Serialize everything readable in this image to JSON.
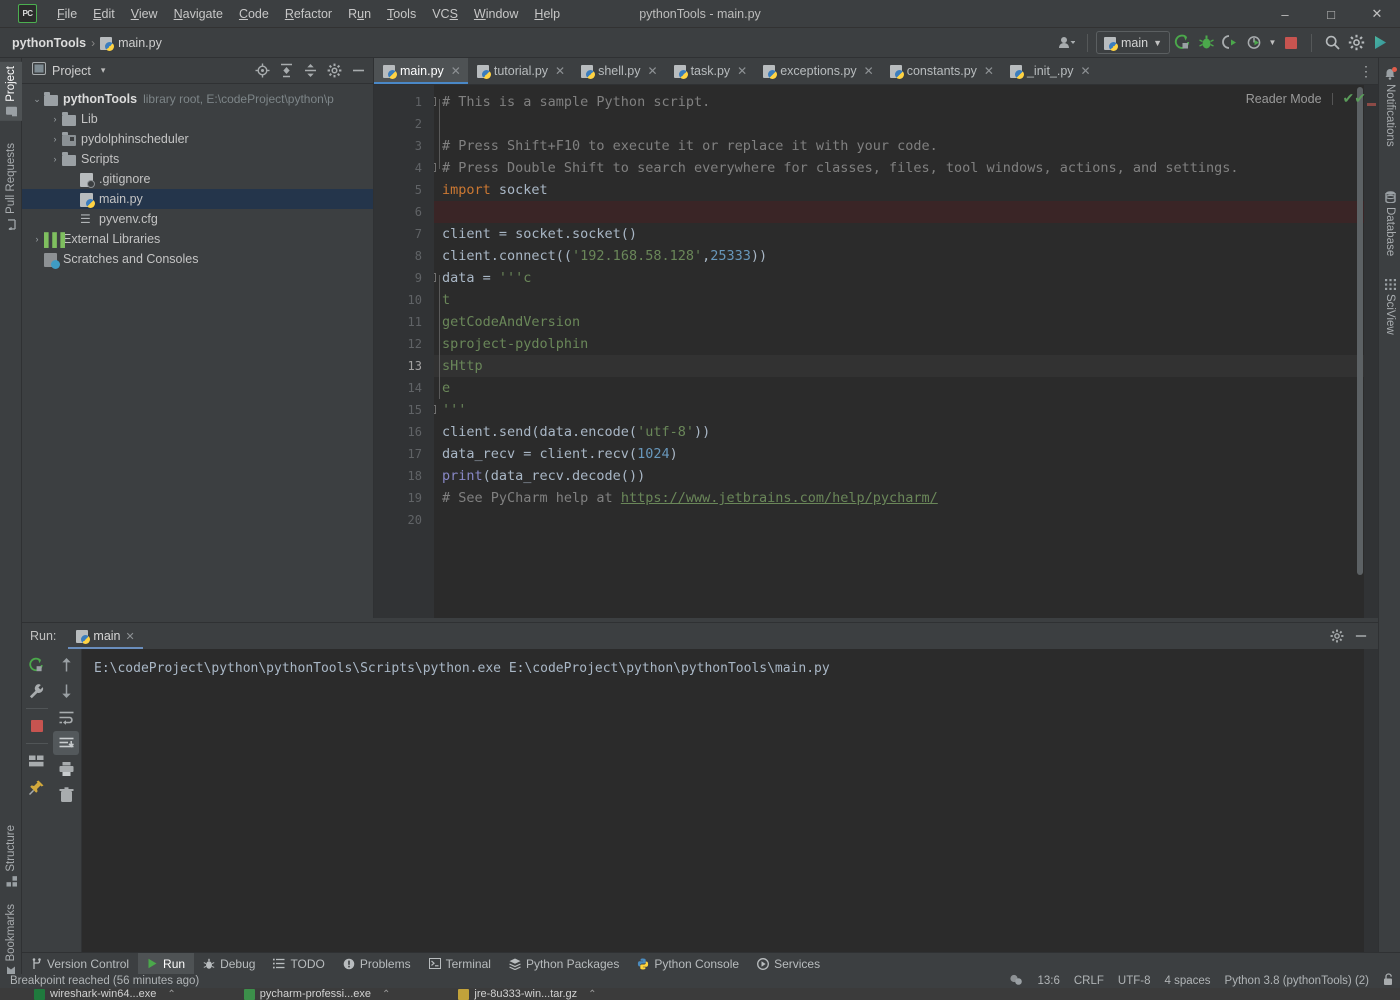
{
  "window": {
    "title": "pythonTools - main.py",
    "logo_text": "PC",
    "controls": {
      "minimize": "–",
      "maximize": "□",
      "close": "✕"
    }
  },
  "menu": [
    {
      "label": "File",
      "mnemonic": "F"
    },
    {
      "label": "Edit",
      "mnemonic": "E"
    },
    {
      "label": "View",
      "mnemonic": "V"
    },
    {
      "label": "Navigate",
      "mnemonic": "N"
    },
    {
      "label": "Code",
      "mnemonic": "C"
    },
    {
      "label": "Refactor",
      "mnemonic": "R"
    },
    {
      "label": "Run",
      "mnemonic": "u"
    },
    {
      "label": "Tools",
      "mnemonic": "T"
    },
    {
      "label": "VCS",
      "mnemonic": "S"
    },
    {
      "label": "Window",
      "mnemonic": "W"
    },
    {
      "label": "Help",
      "mnemonic": "H"
    }
  ],
  "navbar": {
    "breadcrumb_project": "pythonTools",
    "breadcrumb_sep": "›",
    "breadcrumb_file": "main.py",
    "run_config": "main",
    "icons": {
      "account": "account-icon",
      "run": "run-icon",
      "debug": "debug-icon",
      "run_coverage": "run-with-coverage-icon",
      "profile": "profile-icon",
      "stop": "stop-icon",
      "search": "search-everywhere-icon",
      "settings": "settings-icon",
      "updates": "updates-icon"
    }
  },
  "left_strip": {
    "top": [
      {
        "label": "Project",
        "icon": "project-icon",
        "selected": true
      },
      {
        "label": "Pull Requests",
        "icon": "pull-request-icon",
        "selected": false
      }
    ],
    "bottom": [
      {
        "label": "Structure",
        "icon": "structure-icon"
      },
      {
        "label": "Bookmarks",
        "icon": "bookmarks-icon"
      }
    ]
  },
  "right_strip": {
    "items": [
      {
        "label": "Notifications",
        "icon": "bell-icon",
        "badge": true
      },
      {
        "label": "Database",
        "icon": "database-icon",
        "badge": false
      },
      {
        "label": "SciView",
        "icon": "sciview-icon",
        "badge": false
      }
    ]
  },
  "project_panel": {
    "title": "Project",
    "dropdown": "▾",
    "toolbar": [
      {
        "name": "select-opened-file-icon",
        "glyph": "⊕"
      },
      {
        "name": "expand-all-icon",
        "glyph": "⇱"
      },
      {
        "name": "collapse-all-icon",
        "glyph": "⇲"
      },
      {
        "name": "settings-gear-icon",
        "glyph": "⚙"
      },
      {
        "name": "hide-panel-icon",
        "glyph": "—"
      }
    ],
    "tree": [
      {
        "depth": 0,
        "arrow": "⌄",
        "icon": "folder",
        "label": "pythonTools",
        "bold": true,
        "meta": "library root,  E:\\codeProject\\python\\p",
        "selected": false
      },
      {
        "depth": 1,
        "arrow": "›",
        "icon": "folder",
        "label": "Lib",
        "bold": false,
        "meta": "",
        "selected": false
      },
      {
        "depth": 1,
        "arrow": "›",
        "icon": "folder-module",
        "label": "pydolphinscheduler",
        "bold": false,
        "meta": "",
        "selected": false
      },
      {
        "depth": 1,
        "arrow": "›",
        "icon": "folder",
        "label": "Scripts",
        "bold": false,
        "meta": "",
        "selected": false
      },
      {
        "depth": 2,
        "arrow": "",
        "icon": "gitignore",
        "label": ".gitignore",
        "bold": false,
        "meta": "",
        "selected": false
      },
      {
        "depth": 2,
        "arrow": "",
        "icon": "python",
        "label": "main.py",
        "bold": false,
        "meta": "",
        "selected": true
      },
      {
        "depth": 2,
        "arrow": "",
        "icon": "cfg",
        "label": "pyvenv.cfg",
        "bold": false,
        "meta": "",
        "selected": false
      },
      {
        "depth": 0,
        "arrow": "›",
        "icon": "library",
        "label": "External Libraries",
        "bold": false,
        "meta": "",
        "selected": false
      },
      {
        "depth": 0,
        "arrow": "",
        "icon": "scratches",
        "label": "Scratches and Consoles",
        "bold": false,
        "meta": "",
        "selected": false
      }
    ]
  },
  "editor": {
    "tabs": [
      {
        "label": "main.py",
        "active": true
      },
      {
        "label": "tutorial.py",
        "active": false
      },
      {
        "label": "shell.py",
        "active": false
      },
      {
        "label": "task.py",
        "active": false
      },
      {
        "label": "exceptions.py",
        "active": false
      },
      {
        "label": "constants.py",
        "active": false
      },
      {
        "label": "_init_.py",
        "active": false
      }
    ],
    "tab_close_glyph": "✕",
    "more_tabs_glyph": "⋮",
    "reader_mode_label": "Reader Mode",
    "inspection_glyph": "✔",
    "current_line": 13,
    "breakpoint_line": 6,
    "lines": [
      {
        "n": 1,
        "segments": [
          {
            "t": "# This is a sample Python script.",
            "c": "cmt"
          }
        ]
      },
      {
        "n": 2,
        "segments": [
          {
            "t": "",
            "c": ""
          }
        ]
      },
      {
        "n": 3,
        "segments": [
          {
            "t": "# Press Shift+F10 to execute it or replace it with your code.",
            "c": "cmt"
          }
        ]
      },
      {
        "n": 4,
        "segments": [
          {
            "t": "# Press Double Shift to search everywhere for classes, files, tool windows, actions, and settings.",
            "c": "cmt"
          }
        ]
      },
      {
        "n": 5,
        "segments": [
          {
            "t": "import",
            "c": "kw"
          },
          {
            "t": " socket",
            "c": ""
          }
        ]
      },
      {
        "n": 6,
        "segments": [
          {
            "t": "",
            "c": ""
          }
        ]
      },
      {
        "n": 7,
        "segments": [
          {
            "t": "client = socket.socket()",
            "c": ""
          }
        ]
      },
      {
        "n": 8,
        "segments": [
          {
            "t": "client.connect((",
            "c": ""
          },
          {
            "t": "'192.168.58.128'",
            "c": "str"
          },
          {
            "t": ",",
            "c": ""
          },
          {
            "t": "25333",
            "c": "num"
          },
          {
            "t": "))",
            "c": ""
          }
        ]
      },
      {
        "n": 9,
        "segments": [
          {
            "t": "data = ",
            "c": ""
          },
          {
            "t": "'''c",
            "c": "str"
          }
        ]
      },
      {
        "n": 10,
        "segments": [
          {
            "t": "t",
            "c": "str"
          }
        ]
      },
      {
        "n": 11,
        "segments": [
          {
            "t": "getCodeAndVersion",
            "c": "str"
          }
        ]
      },
      {
        "n": 12,
        "segments": [
          {
            "t": "sproject-pydolphin",
            "c": "str"
          }
        ]
      },
      {
        "n": 13,
        "segments": [
          {
            "t": "sHttp",
            "c": "str"
          }
        ]
      },
      {
        "n": 14,
        "segments": [
          {
            "t": "e",
            "c": "str"
          }
        ]
      },
      {
        "n": 15,
        "segments": [
          {
            "t": "'''",
            "c": "str"
          }
        ]
      },
      {
        "n": 16,
        "segments": [
          {
            "t": "client.send(data.encode(",
            "c": ""
          },
          {
            "t": "'utf-8'",
            "c": "str"
          },
          {
            "t": "))",
            "c": ""
          }
        ]
      },
      {
        "n": 17,
        "segments": [
          {
            "t": "data_recv = client.recv(",
            "c": ""
          },
          {
            "t": "1024",
            "c": "num"
          },
          {
            "t": ")",
            "c": ""
          }
        ]
      },
      {
        "n": 18,
        "segments": [
          {
            "t": "print",
            "c": "bi"
          },
          {
            "t": "(data_recv.decode())",
            "c": ""
          }
        ]
      },
      {
        "n": 19,
        "segments": [
          {
            "t": "# See PyCharm help at ",
            "c": "cmt"
          },
          {
            "t": "https://www.jetbrains.com/help/pycharm/",
            "c": "link"
          }
        ]
      },
      {
        "n": 20,
        "segments": [
          {
            "t": "",
            "c": ""
          }
        ]
      }
    ]
  },
  "run_panel": {
    "label": "Run:",
    "tab": "main",
    "tab_close_glyph": "✕",
    "header_icons": [
      {
        "name": "settings-gear-icon",
        "glyph": "⚙"
      },
      {
        "name": "hide-panel-icon",
        "glyph": "—"
      }
    ],
    "tools_left": [
      {
        "name": "rerun-icon",
        "glyph": "↻"
      },
      {
        "name": "wrench-icon",
        "glyph": "🔧"
      },
      {
        "name": "stop-icon",
        "glyph": "■"
      },
      {
        "name": "layout-icon",
        "glyph": "▤"
      },
      {
        "name": "pin-icon",
        "glyph": "📌"
      }
    ],
    "tools_right": [
      {
        "name": "up-arrow-icon",
        "glyph": "↑"
      },
      {
        "name": "down-arrow-icon",
        "glyph": "↓"
      },
      {
        "name": "soft-wrap-icon",
        "glyph": "↵"
      },
      {
        "name": "scroll-to-end-icon",
        "glyph": "↧"
      },
      {
        "name": "print-icon",
        "glyph": "⎙"
      },
      {
        "name": "clear-all-icon",
        "glyph": "🗑"
      }
    ],
    "console_output": "E:\\codeProject\\python\\pythonTools\\Scripts\\python.exe E:\\codeProject\\python\\pythonTools\\main.py"
  },
  "bottom_tabs": [
    {
      "label": "Version Control",
      "icon": "branch-icon",
      "selected": false
    },
    {
      "label": "Run",
      "icon": "run-icon",
      "selected": true
    },
    {
      "label": "Debug",
      "icon": "debug-icon",
      "selected": false
    },
    {
      "label": "TODO",
      "icon": "todo-icon",
      "selected": false
    },
    {
      "label": "Problems",
      "icon": "problems-icon",
      "selected": false
    },
    {
      "label": "Terminal",
      "icon": "terminal-icon",
      "selected": false
    },
    {
      "label": "Python Packages",
      "icon": "packages-icon",
      "selected": false
    },
    {
      "label": "Python Console",
      "icon": "python-console-icon",
      "selected": false
    },
    {
      "label": "Services",
      "icon": "services-icon",
      "selected": false
    }
  ],
  "statusbar": {
    "message": "Breakpoint reached (56 minutes ago)",
    "caret": "13:6",
    "line_separator": "CRLF",
    "encoding": "UTF-8",
    "indent": "4 spaces",
    "interpreter": "Python 3.8 (pythonTools) (2)",
    "lock_icon": "unlocked-icon",
    "inspector_icon": "inspector-icon"
  },
  "os_taskbar": [
    {
      "label": "wireshark-win64...exe",
      "color": "#1f7a3d"
    },
    {
      "label": "pycharm-professi...exe",
      "color": "#3c8f4a"
    },
    {
      "label": "jre-8u333-win...tar.gz",
      "color": "#c2a23a"
    }
  ],
  "colors": {
    "accent": "#4a88c7",
    "selection": "#24354b",
    "breakpoint": "#c75450",
    "string": "#6a8759",
    "keyword": "#cc7832",
    "number": "#6897bb",
    "comment": "#808080",
    "editor_bg": "#2b2b2b",
    "chrome_bg": "#3c3f41"
  }
}
